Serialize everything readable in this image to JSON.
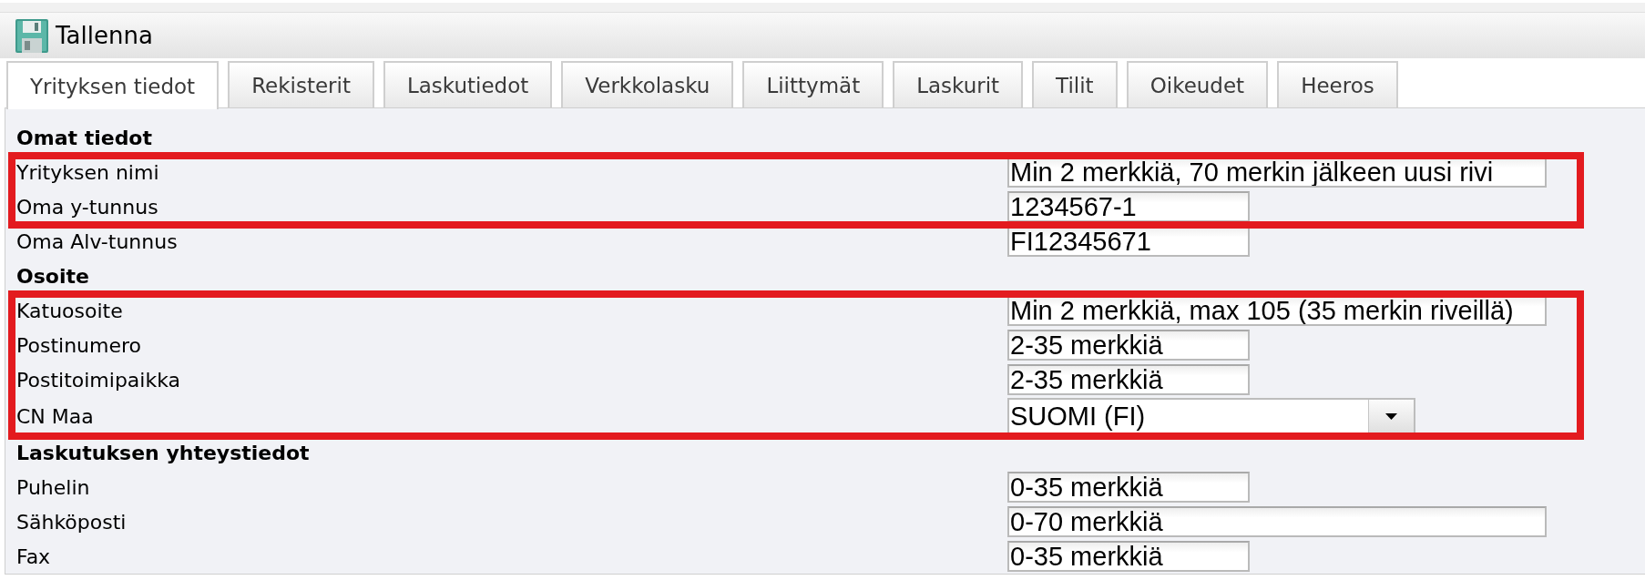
{
  "toolbar": {
    "save_button": {
      "label": "Tallenna"
    }
  },
  "tabs": [
    {
      "label": "Yrityksen tiedot",
      "selected": true
    },
    {
      "label": "Rekisterit",
      "selected": false
    },
    {
      "label": "Laskutiedot",
      "selected": false
    },
    {
      "label": "Verkkolasku",
      "selected": false
    },
    {
      "label": "Liittymät",
      "selected": false
    },
    {
      "label": "Laskurit",
      "selected": false
    },
    {
      "label": "Tilit",
      "selected": false
    },
    {
      "label": "Oikeudet",
      "selected": false
    },
    {
      "label": "Heeros",
      "selected": false
    }
  ],
  "sections": [
    {
      "title": "Omat tiedot",
      "rows": [
        {
          "label": "Yrityksen nimi",
          "kind": "text_long",
          "placeholder": "Min 2 merkkiä, 70 merkin jälkeen uusi rivi",
          "highlighted": true
        },
        {
          "label": "Oma y-tunnus",
          "kind": "text_short",
          "placeholder": "1234567-1",
          "highlighted": true
        },
        {
          "label": "Oma Alv-tunnus",
          "kind": "text_short",
          "placeholder": "FI12345671",
          "highlighted": false
        }
      ]
    },
    {
      "title": "Osoite",
      "rows": [
        {
          "label": "Katuosoite",
          "kind": "text_long",
          "placeholder": "Min 2 merkkiä, max 105 (35 merkin riveillä)",
          "highlighted": true
        },
        {
          "label": "Postinumero",
          "kind": "text_short",
          "placeholder": "2-35 merkkiä",
          "highlighted": true
        },
        {
          "label": "Postitoimipaikka",
          "kind": "text_short",
          "placeholder": "2-35 merkkiä",
          "highlighted": true
        },
        {
          "label": "CN Maa",
          "kind": "select",
          "value": "SUOMI (FI)",
          "highlighted": true
        }
      ]
    },
    {
      "title": "Laskutuksen yhteystiedot",
      "rows": [
        {
          "label": "Puhelin",
          "kind": "text_short",
          "placeholder": "0-35 merkkiä",
          "highlighted": false
        },
        {
          "label": "Sähköposti",
          "kind": "text_long",
          "placeholder": "0-70 merkkiä",
          "highlighted": false
        },
        {
          "label": "Fax",
          "kind": "text_short",
          "placeholder": "0-35 merkkiä",
          "highlighted": false
        }
      ]
    }
  ]
}
